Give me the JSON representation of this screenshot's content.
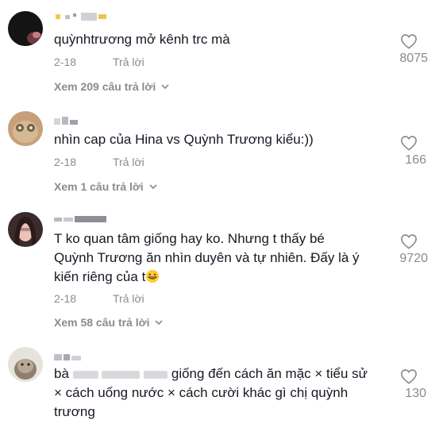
{
  "comments": [
    {
      "text": "quỳnhtrương mở kênh trc mà",
      "date": "2-18",
      "reply_label": "Trả lời",
      "likes": "8075",
      "view_replies": "Xem 209 câu trả lời"
    },
    {
      "text": "nhìn cap của Hina vs Quỳnh Trương kiểu:))",
      "date": "2-18",
      "reply_label": "Trả lời",
      "likes": "166",
      "view_replies": "Xem 1 câu trả lời"
    },
    {
      "text_line1": "T ko quan tâm giống hay ko. Nhưng t thấy bé",
      "text_line2": "Quỳnh Trương ăn nhìn duyên và tự nhiên. Đấy là ý",
      "text_line3": "kiến riêng của t",
      "date": "2-18",
      "reply_label": "Trả lời",
      "likes": "9720",
      "view_replies": "Xem 58 câu trả lời"
    },
    {
      "text_prefix": "bà",
      "text_mid": "giống đến cách ăn mặc × tiểu sử",
      "text_line2": "× cách uống nước × cách cười khác gì chị quỳnh",
      "text_line3": "trương",
      "likes": "130"
    }
  ],
  "icons": {
    "like": "heart-outline-icon",
    "expand": "chevron-down-icon",
    "emoji": "grinning-face-emoji"
  },
  "colors": {
    "text": "#161823",
    "secondary": "#8a8b91",
    "background": "#ffffff"
  }
}
